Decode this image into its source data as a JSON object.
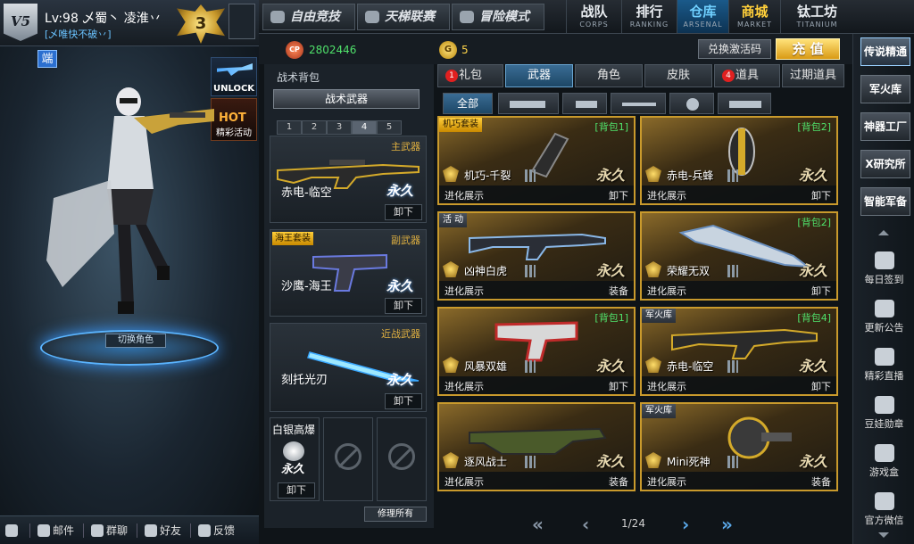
{
  "profile": {
    "level": "Lv:98 乄蜀丶 凌淮丷",
    "clan": "[乄唯快不破丷]",
    "rank_number": "3",
    "logo_text": "V5",
    "duan": "端"
  },
  "promos": {
    "unlock": "UNLOCK",
    "hot": "HOT",
    "hot_sub": "精彩活动"
  },
  "character": {
    "switch_label": "切换角色"
  },
  "bottom_bar": {
    "settings": "",
    "mail": "邮件",
    "group_chat": "群聊",
    "friends": "好友",
    "feedback": "反馈"
  },
  "top_nav": {
    "modes": [
      "自由竞技",
      "天梯联赛",
      "冒险模式"
    ],
    "nav": [
      {
        "cn": "战队",
        "en": "CORPS"
      },
      {
        "cn": "排行",
        "en": "RANKING"
      },
      {
        "cn": "仓库",
        "en": "ARSENAL"
      },
      {
        "cn": "商城",
        "en": "MARKET"
      },
      {
        "cn": "钛工坊",
        "en": "TITANIUM"
      }
    ]
  },
  "currency": {
    "cp_label": "CP",
    "cp": "2802446",
    "g_label": "G",
    "gold": "5",
    "redeem": "兑换激活码",
    "recharge": "充 值"
  },
  "backpack": {
    "title": "战术背包",
    "tactical": "战术武器",
    "slots": [
      "1",
      "2",
      "3",
      "4",
      "5"
    ],
    "primary": {
      "category": "主武器",
      "name": "赤电-临空",
      "perm": "永久",
      "unload": "卸下"
    },
    "secondary": {
      "category": "副武器",
      "tag": "海王套装",
      "name": "沙鹰-海王",
      "perm": "永久",
      "unload": "卸下"
    },
    "melee": {
      "category": "近战武器",
      "name": "刻托光刃",
      "perm": "永久",
      "unload": "卸下"
    },
    "grenade": {
      "name": "白银高爆",
      "perm": "永久",
      "unload": "卸下"
    },
    "repair": "修理所有"
  },
  "inventory": {
    "tabs": [
      {
        "label": "礼包",
        "badge": "1"
      },
      {
        "label": "武器",
        "badge": ""
      },
      {
        "label": "角色",
        "badge": ""
      },
      {
        "label": "皮肤",
        "badge": ""
      },
      {
        "label": "道具",
        "badge": "4"
      },
      {
        "label": "过期道具",
        "badge": ""
      }
    ],
    "filter_all": "全部",
    "evo_label": "进化展示",
    "cards": [
      {
        "name": "机巧-千裂",
        "tag": "机巧套装",
        "bag": "[背包1]",
        "perm": "永久",
        "action": "卸下"
      },
      {
        "name": "赤电-兵蜂",
        "tag": "",
        "bag": "[背包2]",
        "perm": "永久",
        "action": "卸下"
      },
      {
        "name": "凶神白虎",
        "tag": "活 动",
        "bag": "",
        "perm": "永久",
        "action": "装备"
      },
      {
        "name": "荣耀无双",
        "tag": "",
        "bag": "[背包2]",
        "perm": "永久",
        "action": "卸下"
      },
      {
        "name": "风暴双雄",
        "tag": "",
        "bag": "[背包1]",
        "perm": "永久",
        "action": "卸下"
      },
      {
        "name": "赤电-临空",
        "tag": "军火库",
        "bag": "[背包4]",
        "perm": "永久",
        "action": "卸下"
      },
      {
        "name": "逐风战士",
        "tag": "",
        "bag": "",
        "perm": "永久",
        "action": "装备"
      },
      {
        "name": "Mini死神",
        "tag": "军火库",
        "bag": "",
        "perm": "永久",
        "action": "装备"
      }
    ],
    "page": "1/24"
  },
  "right_bar": {
    "buttons": [
      "传说精通",
      "军火库",
      "神器工厂",
      "X研究所",
      "智能军备"
    ],
    "items": [
      "每日签到",
      "更新公告",
      "精彩直播",
      "豆娃勋章",
      "游戏盒",
      "官方微信"
    ]
  }
}
